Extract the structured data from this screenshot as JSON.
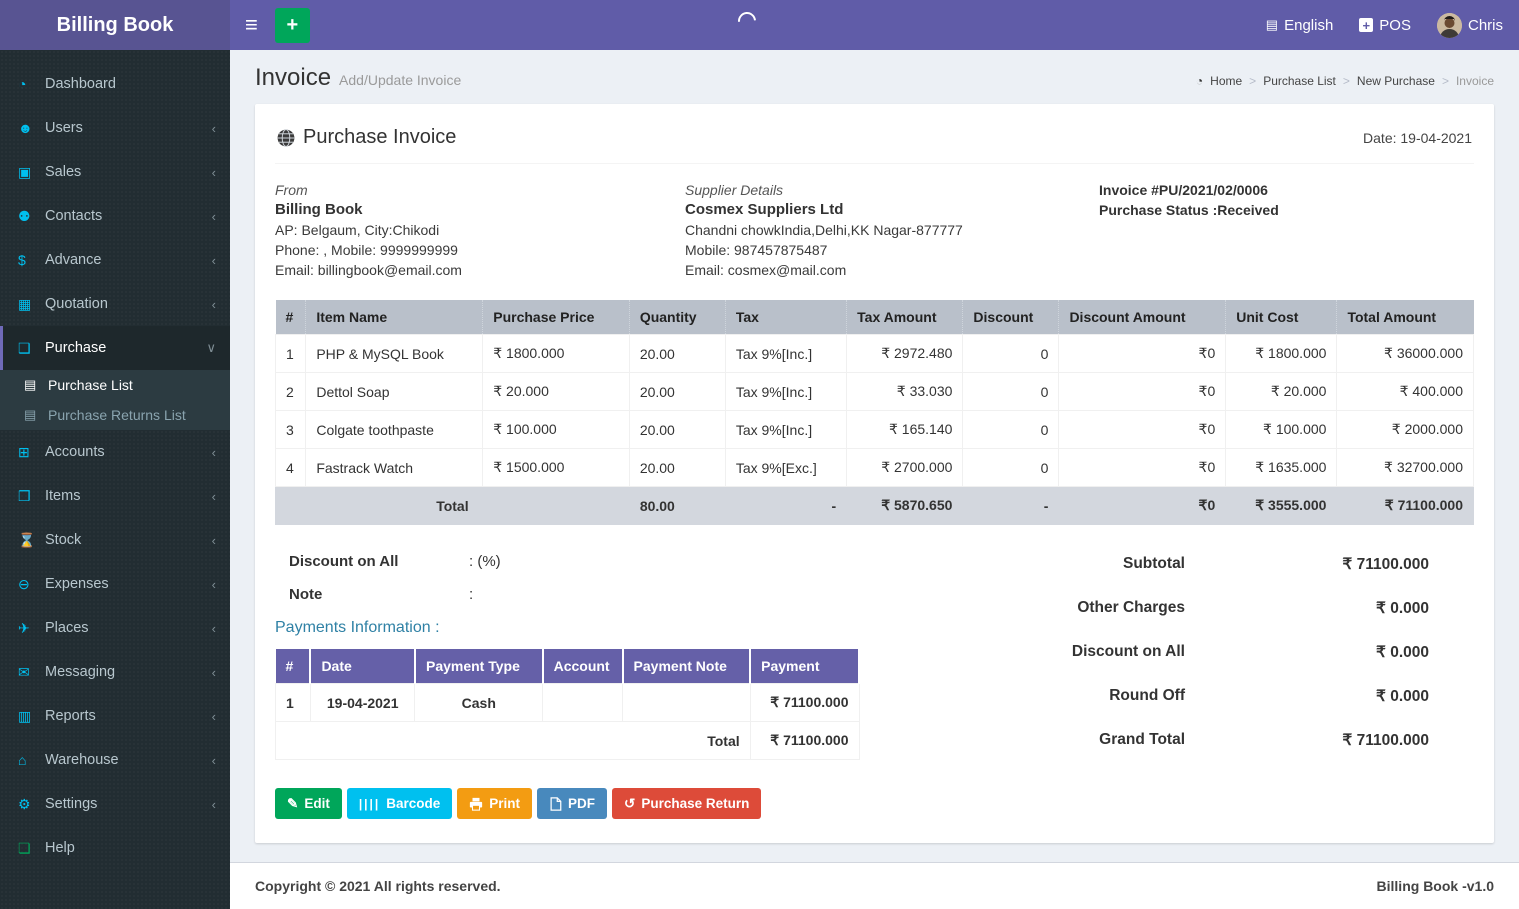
{
  "navbar": {
    "brand": "Billing Book",
    "hamburger_glyph": "≡",
    "new_button_glyph": "+",
    "language_glyph": "▤",
    "language": "English",
    "pos_glyph": "+",
    "pos": "POS",
    "user": "Chris"
  },
  "sidebar": {
    "items": [
      {
        "label": "Dashboard",
        "glyph": "◔"
      },
      {
        "label": "Users",
        "glyph": "☻",
        "chevron": "‹"
      },
      {
        "label": "Sales",
        "glyph": "▣",
        "chevron": "‹"
      },
      {
        "label": "Contacts",
        "glyph": "⚉",
        "chevron": "‹"
      },
      {
        "label": "Advance",
        "glyph": "$",
        "chevron": "‹"
      },
      {
        "label": "Quotation",
        "glyph": "▦",
        "chevron": "‹"
      },
      {
        "label": "Purchase",
        "glyph": "❑",
        "chevron": "∨"
      },
      {
        "label": "Purchase List",
        "glyph": "▤"
      },
      {
        "label": "Purchase Returns List",
        "glyph": "▤"
      },
      {
        "label": "Accounts",
        "glyph": "⊞",
        "chevron": "‹"
      },
      {
        "label": "Items",
        "glyph": "❒",
        "chevron": "‹"
      },
      {
        "label": "Stock",
        "glyph": "⌛",
        "chevron": "‹"
      },
      {
        "label": "Expenses",
        "glyph": "⊖",
        "chevron": "‹"
      },
      {
        "label": "Places",
        "glyph": "✈",
        "chevron": "‹"
      },
      {
        "label": "Messaging",
        "glyph": "✉",
        "chevron": "‹"
      },
      {
        "label": "Reports",
        "glyph": "▥",
        "chevron": "‹"
      },
      {
        "label": "Warehouse",
        "glyph": "⌂",
        "chevron": "‹"
      },
      {
        "label": "Settings",
        "glyph": "⚙",
        "chevron": "‹"
      },
      {
        "label": "Help",
        "glyph": "❏"
      }
    ]
  },
  "page": {
    "title": "Invoice",
    "subtitle": "Add/Update Invoice",
    "breadcrumb": {
      "home_glyph": "◔",
      "home": "Home",
      "sep": ">",
      "items": [
        "Purchase List",
        "New Purchase",
        "Invoice"
      ]
    }
  },
  "invoice": {
    "title": "Purchase Invoice",
    "date": "Date: 19-04-2021",
    "from": {
      "heading": "From",
      "name": "Billing Book",
      "address": "AP: Belgaum, City:Chikodi",
      "phone": "Phone: , Mobile: 9999999999",
      "email": "Email: billingbook@email.com"
    },
    "supplier": {
      "heading": "Supplier Details",
      "name": "Cosmex Suppliers Ltd",
      "address": "Chandni chowkIndia,Delhi,KK Nagar-877777",
      "phone": "Mobile: 987457875487",
      "email": "Email: cosmex@mail.com"
    },
    "meta": {
      "number": "Invoice #PU/2021/02/0006",
      "status": "Purchase Status :Received"
    },
    "items_table": {
      "headers": [
        "#",
        "Item Name",
        "Purchase Price",
        "Quantity",
        "Tax",
        "Tax Amount",
        "Discount",
        "Discount Amount",
        "Unit Cost",
        "Total Amount"
      ],
      "rows": [
        [
          "1",
          "PHP & MySQL Book",
          "₹ 1800.000",
          "20.00",
          "Tax 9%[Inc.]",
          "₹ 2972.480",
          "0",
          "₹0",
          "₹ 1800.000",
          "₹ 36000.000"
        ],
        [
          "2",
          "Dettol Soap",
          "₹ 20.000",
          "20.00",
          "Tax 9%[Inc.]",
          "₹ 33.030",
          "0",
          "₹0",
          "₹ 20.000",
          "₹ 400.000"
        ],
        [
          "3",
          "Colgate toothpaste",
          "₹ 100.000",
          "20.00",
          "Tax 9%[Inc.]",
          "₹ 165.140",
          "0",
          "₹0",
          "₹ 100.000",
          "₹ 2000.000"
        ],
        [
          "4",
          "Fastrack Watch",
          "₹ 1500.000",
          "20.00",
          "Tax 9%[Exc.]",
          "₹ 2700.000",
          "0",
          "₹0",
          "₹ 1635.000",
          "₹ 32700.000"
        ]
      ],
      "total": {
        "label": "Total",
        "quantity": "80.00",
        "tax": "-",
        "tax_amount": "₹ 5870.650",
        "discount": "-",
        "discount_amount": "₹0",
        "unit_cost": "₹ 3555.000",
        "total_amount": "₹ 71100.000"
      }
    },
    "discount_on_all": {
      "label": "Discount on All",
      "value": ": (%)"
    },
    "note": {
      "label": "Note",
      "value": ":"
    },
    "payments": {
      "title": "Payments Information :",
      "headers": [
        "#",
        "Date",
        "Payment Type",
        "Account",
        "Payment Note",
        "Payment"
      ],
      "rows": [
        [
          "1",
          "19-04-2021",
          "Cash",
          "",
          "",
          "₹ 71100.000"
        ]
      ],
      "total_label": "Total",
      "total_value": "₹ 71100.000"
    },
    "summary": [
      {
        "label": "Subtotal",
        "value": "₹ 71100.000"
      },
      {
        "label": "Other Charges",
        "value": "₹ 0.000"
      },
      {
        "label": "Discount on All",
        "value": "₹ 0.000"
      },
      {
        "label": "Round Off",
        "value": "₹ 0.000"
      },
      {
        "label": "Grand Total",
        "value": "₹ 71100.000"
      }
    ],
    "actions": [
      {
        "label": "Edit",
        "glyph": "✎",
        "color": "#00a65a"
      },
      {
        "label": "Barcode",
        "glyph": "||||",
        "color": "#00c0ef"
      },
      {
        "label": "Print",
        "color": "#f39c12"
      },
      {
        "label": "PDF",
        "color": "#4889bd"
      },
      {
        "label": "Purchase Return",
        "glyph": "↺",
        "color": "#dd4b39"
      }
    ]
  },
  "footer": {
    "left": "Copyright © 2021 All rights reserved.",
    "right": "Billing Book -v1.0"
  },
  "colors": {
    "navbar": "#605ca8",
    "brand_bg": "#585492",
    "sidebar_bg": "#222d32",
    "sidebar_icon": "#00c0ef",
    "items_header_bg": "#b9c0ca",
    "items_total_bg": "#d3d7de",
    "payments_header_bg": "#6560a8",
    "content_bg": "#ecf0f5"
  }
}
